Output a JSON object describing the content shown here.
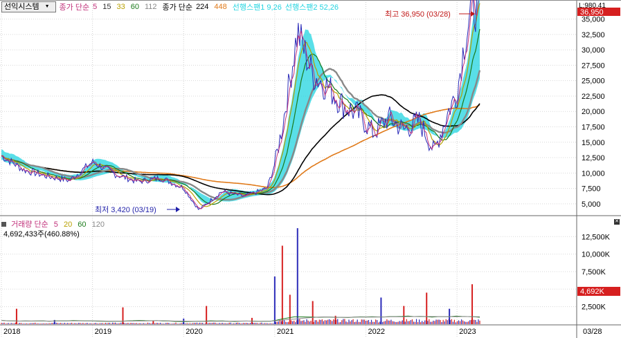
{
  "stock_selector": {
    "name": "선익시스템"
  },
  "legend": {
    "ma_label": "종가 단순",
    "ma_periods": [
      "5",
      "15",
      "33",
      "60",
      "112"
    ],
    "ma_colors": [
      "#c0307a",
      "#333333",
      "#b8a000",
      "#1a7a1a",
      "#888888"
    ],
    "long_label": "종가 단순",
    "long_periods": [
      "224",
      "448"
    ],
    "long_colors": [
      "#000000",
      "#e07a1a"
    ],
    "span1": "선행스팬1 9,26",
    "span2": "선행스팬2 52,26",
    "span_color": "#22d4e0"
  },
  "top_right": {
    "label": "L:980.41",
    "current_price": "36,950"
  },
  "annotations": {
    "high": "최고 36,950 (03/28)",
    "low": "최저 3,420 (03/19)"
  },
  "volume_legend": {
    "label": "거래량 단순",
    "periods": [
      "5",
      "20",
      "60",
      "120"
    ],
    "colors": [
      "#c0307a",
      "#b8a000",
      "#1a7a1a",
      "#888888"
    ],
    "info": "4,692,433주(460.88%)",
    "current_volume": "4,692K"
  },
  "x_axis": {
    "years": [
      "2018",
      "2019",
      "2020",
      "2021",
      "2022",
      "2023"
    ],
    "right_date": "03/28"
  },
  "chart_data": [
    {
      "type": "line",
      "title": "",
      "yticks": [
        "35,000",
        "32,500",
        "30,000",
        "27,500",
        "25,000",
        "22,500",
        "20,000",
        "17,500",
        "15,000",
        "12,500",
        "10,000",
        "7,500",
        "5,000"
      ],
      "ylim": [
        3300,
        37200
      ],
      "x": [
        "2018-01",
        "2018-04",
        "2018-07",
        "2018-10",
        "2019-01",
        "2019-04",
        "2019-07",
        "2019-10",
        "2020-01",
        "2020-03",
        "2020-06",
        "2020-09",
        "2020-12",
        "2021-01",
        "2021-02",
        "2021-04",
        "2021-06",
        "2021-08",
        "2021-10",
        "2021-12",
        "2022-02",
        "2022-04",
        "2022-06",
        "2022-08",
        "2022-10",
        "2022-12",
        "2023-01",
        "2023-02",
        "2023-03"
      ],
      "series": [
        {
          "values": [
            12800,
            10500,
            9500,
            8800,
            11800,
            9800,
            8600,
            9200,
            7600,
            4000,
            7000,
            6200,
            7500,
            11500,
            17500,
            33000,
            26000,
            24000,
            21000,
            19500,
            16500,
            19000,
            17000,
            18500,
            13500,
            20500,
            23000,
            31500,
            36950
          ]
        }
      ],
      "annotations": [
        {
          "text": "최고 36,950 (03/28)",
          "x": "2023-03",
          "y": 36950
        },
        {
          "text": "최저 3,420 (03/19)",
          "x": "2020-03",
          "y": 3420
        }
      ]
    },
    {
      "type": "bar",
      "title": "",
      "yticks": [
        "12,500K",
        "10,000K",
        "7,500K",
        "5,000K",
        "2,500K"
      ],
      "ylim": [
        0,
        14500
      ],
      "x": [
        "2018-03",
        "2018-08",
        "2019-05",
        "2019-09",
        "2020-01",
        "2020-04",
        "2020-10",
        "2021-01",
        "2021-02",
        "2021-03",
        "2021-04",
        "2021-06",
        "2021-09",
        "2022-03",
        "2022-06",
        "2022-09",
        "2022-12",
        "2023-03"
      ],
      "values": [
        2200,
        600,
        2400,
        500,
        800,
        2600,
        900,
        6800,
        11200,
        4200,
        13700,
        3300,
        1200,
        3800,
        2600,
        4500,
        2200,
        5700
      ]
    }
  ]
}
